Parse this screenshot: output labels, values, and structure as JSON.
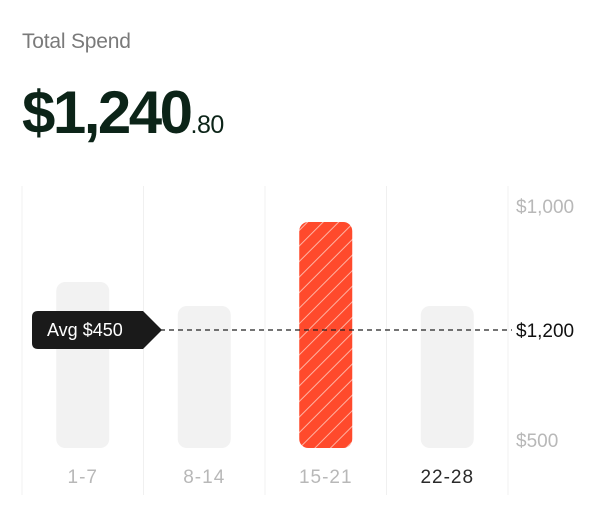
{
  "header": {
    "title": "Total Spend",
    "amount_main": "$1,240",
    "amount_cents": ".80"
  },
  "colors": {
    "bar": "#f2f2f2",
    "highlight": "#ff4a2c",
    "highlight_stripe": "#ffb3a3",
    "grid": "#f0f0f0",
    "badge": "#1a1a1a",
    "text_dark": "#0c2418",
    "text_muted": "#b8b8b8"
  },
  "chart_data": {
    "type": "bar",
    "categories": [
      "1-7",
      "8-14",
      "15-21",
      "22-28"
    ],
    "values": [
      650,
      550,
      900,
      550
    ],
    "highlighted_index": 2,
    "active_label_index": 3,
    "ylim": [
      0,
      1000
    ],
    "y_tick_labels": [
      "$1,000",
      "$1,200",
      "$500"
    ],
    "average": {
      "label": "Avg $450",
      "value": 450
    },
    "grid": true
  }
}
